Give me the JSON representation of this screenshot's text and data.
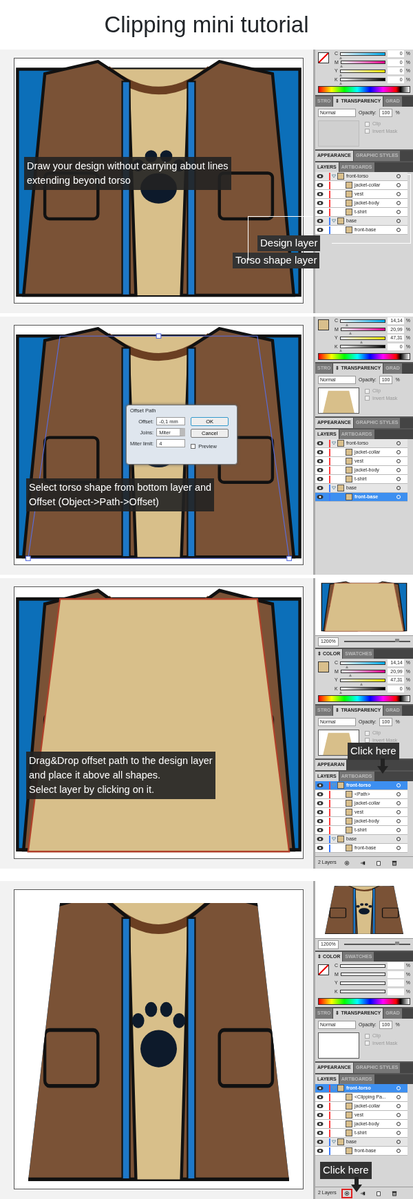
{
  "title": "Clipping mini tutorial",
  "steps": [
    {
      "art": {
        "kind": "jacket"
      },
      "captions": [
        {
          "lines": [
            "Draw your design without carrying about lines",
            "extending beyond torso"
          ]
        }
      ],
      "labels": [
        "Design layer",
        "Torso shape layer"
      ],
      "panel": {
        "color": {
          "fill": {
            "kind": "none"
          },
          "channels": [
            {
              "name": "C",
              "value": "0",
              "level": 0
            },
            {
              "name": "M",
              "value": "0",
              "level": 0
            },
            {
              "name": "Y",
              "value": "0",
              "level": 0
            },
            {
              "name": "K",
              "value": "0",
              "level": 0
            }
          ],
          "unit": "%"
        },
        "transparency": {
          "tabs": [
            {
              "label": "STRO",
              "selected": false
            },
            {
              "label": "⇕ TRANSPARENCY",
              "selected": true
            },
            {
              "label": "GRAD",
              "selected": false
            }
          ],
          "mode": "Normal",
          "opacity_label": "Opacity:",
          "opacity": "100",
          "unit": "%",
          "thumbnail": {
            "kind": "empty"
          },
          "options": [
            {
              "label": "Clip",
              "disabled": true
            },
            {
              "label": "Invert Mask",
              "disabled": true
            }
          ]
        },
        "appearance_tabs": [
          {
            "label": "APPEARANCE",
            "selected": true
          },
          {
            "label": "GRAPHIC STYLES",
            "selected": false
          }
        ],
        "layers": {
          "tabs": [
            {
              "label": "LAYERS",
              "selected": true
            },
            {
              "label": "ARTBOARDS",
              "selected": false
            }
          ],
          "items": [
            {
              "name": "front-torso",
              "color": "#ff3b3b",
              "expanded": true,
              "selected": false,
              "children": [
                {
                  "name": "jacket-collar",
                  "selected": false
                },
                {
                  "name": "vest",
                  "selected": false
                },
                {
                  "name": "jacket-body",
                  "selected": false
                },
                {
                  "name": "t-shirt",
                  "selected": false
                }
              ]
            },
            {
              "name": "base",
              "color": "#3b7bff",
              "expanded": true,
              "selected": false,
              "children": [
                {
                  "name": "front-base",
                  "selected": false
                }
              ]
            }
          ]
        }
      }
    },
    {
      "art": {
        "kind": "jacket-selected"
      },
      "captions": [
        {
          "lines": [
            "Select torso shape from bottom layer and",
            "Offset (Object->Path->Offset)"
          ]
        }
      ],
      "dialog": {
        "title": "Offset Path",
        "fields": [
          {
            "label": "Offset:",
            "value": "-0,1 mm",
            "kind": "text"
          },
          {
            "label": "Joins:",
            "value": "Miter",
            "kind": "select"
          },
          {
            "label": "Miter limit:",
            "value": "4",
            "kind": "text"
          }
        ],
        "buttons": [
          "OK",
          "Cancel"
        ],
        "checkbox": {
          "label": "Preview",
          "checked": false
        }
      },
      "panel": {
        "color": {
          "fill": {
            "kind": "solid",
            "color": "#d9bf8c"
          },
          "channels": [
            {
              "name": "C",
              "value": "14,14",
              "level": 0.14
            },
            {
              "name": "M",
              "value": "20,99",
              "level": 0.21
            },
            {
              "name": "Y",
              "value": "47,31",
              "level": 0.47
            },
            {
              "name": "K",
              "value": "0",
              "level": 0
            }
          ],
          "unit": "%"
        },
        "transparency": {
          "tabs": [
            {
              "label": "STRO",
              "selected": false
            },
            {
              "label": "⇕ TRANSPARENCY",
              "selected": true
            },
            {
              "label": "GRAD",
              "selected": false
            }
          ],
          "mode": "Normal",
          "opacity_label": "Opacity:",
          "opacity": "100",
          "unit": "%",
          "thumbnail": {
            "kind": "shape"
          },
          "options": [
            {
              "label": "Clip",
              "disabled": true
            },
            {
              "label": "Invert Mask",
              "disabled": true
            }
          ]
        },
        "appearance_tabs": [
          {
            "label": "APPEARANCE",
            "selected": true
          },
          {
            "label": "GRAPHIC STYLES",
            "selected": false
          }
        ],
        "layers": {
          "tabs": [
            {
              "label": "LAYERS",
              "selected": true
            },
            {
              "label": "ARTBOARDS",
              "selected": false
            }
          ],
          "items": [
            {
              "name": "front-torso",
              "color": "#ff3b3b",
              "expanded": true,
              "selected": false,
              "children": [
                {
                  "name": "jacket-collar",
                  "selected": false
                },
                {
                  "name": "vest",
                  "selected": false
                },
                {
                  "name": "jacket-body",
                  "selected": false
                },
                {
                  "name": "t-shirt",
                  "selected": false
                }
              ]
            },
            {
              "name": "base",
              "color": "#3b7bff",
              "expanded": true,
              "selected": false,
              "children": [
                {
                  "name": "front-base",
                  "selected": true
                }
              ]
            }
          ]
        }
      }
    },
    {
      "art": {
        "kind": "offset-path"
      },
      "captions": [
        {
          "lines": [
            "Drag&Drop offset path to the design layer",
            "and place it above all shapes.",
            "Select layer by clicking on it."
          ]
        }
      ],
      "hint": "Click here",
      "panel": {
        "preview": {
          "kind": "offset-path",
          "zoom": "1200%",
          "level": 0.8
        },
        "color": {
          "tabs": [
            {
              "label": "⇕ COLOR",
              "selected": true
            },
            {
              "label": "SWATCHES",
              "selected": false
            }
          ],
          "fill": {
            "kind": "solid",
            "color": "#d9bf8c"
          },
          "channels": [
            {
              "name": "C",
              "value": "14,14",
              "level": 0.14
            },
            {
              "name": "M",
              "value": "20,99",
              "level": 0.21
            },
            {
              "name": "Y",
              "value": "47,31",
              "level": 0.47
            },
            {
              "name": "K",
              "value": "0",
              "level": 0
            }
          ],
          "unit": "%"
        },
        "transparency": {
          "tabs": [
            {
              "label": "STRO",
              "selected": false
            },
            {
              "label": "⇕ TRANSPARENCY",
              "selected": true
            },
            {
              "label": "GRAD",
              "selected": false
            }
          ],
          "mode": "Normal",
          "opacity_label": "Opacity:",
          "opacity": "100",
          "unit": "%",
          "thumbnail": {
            "kind": "shape"
          },
          "options": [
            {
              "label": "Clip",
              "disabled": true
            },
            {
              "label": "Invert Mask",
              "disabled": true
            }
          ]
        },
        "appearance_tabs": [
          {
            "label": "APPEARAN",
            "selected": true
          }
        ],
        "layers": {
          "tabs": [
            {
              "label": "LAYERS",
              "selected": true
            },
            {
              "label": "ARTBOARDS",
              "selected": false
            }
          ],
          "items": [
            {
              "name": "front-torso",
              "color": "#ff3b3b",
              "expanded": true,
              "selected": true,
              "children": [
                {
                  "name": "<Path>",
                  "selected": false
                },
                {
                  "name": "jacket-collar",
                  "selected": false
                },
                {
                  "name": "vest",
                  "selected": false
                },
                {
                  "name": "jacket-body",
                  "selected": false
                },
                {
                  "name": "t-shirt",
                  "selected": false
                }
              ]
            },
            {
              "name": "base",
              "color": "#3b7bff",
              "expanded": true,
              "selected": false,
              "children": [
                {
                  "name": "front-base",
                  "selected": false
                }
              ]
            }
          ]
        },
        "footer": {
          "count": "2 Layers",
          "buttons": [
            {
              "kind": "clip",
              "highlighted": false
            },
            {
              "kind": "sublayer",
              "highlighted": false
            },
            {
              "kind": "layer",
              "highlighted": false
            },
            {
              "kind": "delete",
              "highlighted": false
            }
          ]
        }
      }
    },
    {
      "art": {
        "kind": "clipped"
      },
      "hint": "Click here",
      "panel": {
        "preview": {
          "kind": "clipped",
          "zoom": "1200%",
          "level": 0.8
        },
        "color": {
          "tabs": [
            {
              "label": "⇕ COLOR",
              "selected": true
            },
            {
              "label": "SWATCHES",
              "selected": false
            }
          ],
          "fill": {
            "kind": "none"
          },
          "channels": [
            {
              "name": "C"
            },
            {
              "name": "M"
            },
            {
              "name": "Y"
            },
            {
              "name": "K"
            }
          ],
          "unit": "%"
        },
        "transparency": {
          "tabs": [
            {
              "label": "STRO",
              "selected": false
            },
            {
              "label": "⇕ TRANSPARENCY",
              "selected": true
            },
            {
              "label": "GRAD",
              "selected": false
            }
          ],
          "mode": "Normal",
          "opacity_label": "Opacity:",
          "opacity": "100",
          "unit": "%",
          "thumbnail": {
            "kind": "blank"
          },
          "options": [
            {
              "label": "Clip",
              "disabled": true
            },
            {
              "label": "Invert Mask",
              "disabled": true
            }
          ]
        },
        "appearance_tabs": [
          {
            "label": "APPEARANCE",
            "selected": true
          },
          {
            "label": "GRAPHIC STYLES",
            "selected": false
          }
        ],
        "layers": {
          "tabs": [
            {
              "label": "LAYERS",
              "selected": true
            },
            {
              "label": "ARTBOARDS",
              "selected": false
            }
          ],
          "items": [
            {
              "name": "front-torso",
              "color": "#ff3b3b",
              "expanded": true,
              "selected": true,
              "children": [
                {
                  "name": "<Clipping Pa...",
                  "selected": false
                },
                {
                  "name": "jacket-collar",
                  "selected": false
                },
                {
                  "name": "vest",
                  "selected": false
                },
                {
                  "name": "jacket-body",
                  "selected": false
                },
                {
                  "name": "t-shirt",
                  "selected": false
                }
              ]
            },
            {
              "name": "base",
              "color": "#3b7bff",
              "expanded": true,
              "selected": false,
              "children": [
                {
                  "name": "front-base",
                  "selected": false
                }
              ]
            }
          ]
        },
        "footer": {
          "count": "2 Layers",
          "buttons": [
            {
              "kind": "clip",
              "highlighted": true
            },
            {
              "kind": "sublayer",
              "highlighted": false
            },
            {
              "kind": "layer",
              "highlighted": false
            },
            {
              "kind": "delete",
              "highlighted": false
            }
          ]
        }
      }
    }
  ]
}
